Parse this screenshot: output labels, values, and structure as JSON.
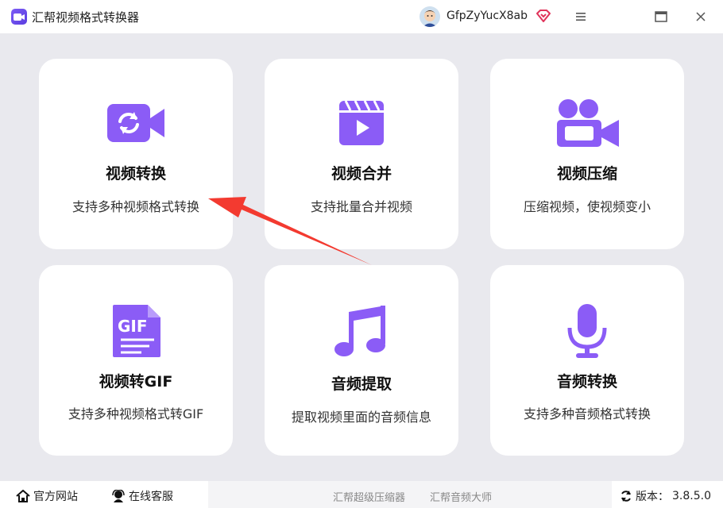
{
  "app": {
    "title": "汇帮视频格式转换器",
    "username": "GfpZyYucX8ab"
  },
  "colors": {
    "accent": "#8b5cf6",
    "arrow": "#f33a30",
    "vip": "#e0335a"
  },
  "cards": [
    {
      "title": "视频转换",
      "desc": "支持多种视频格式转换",
      "icon": "video-convert-icon"
    },
    {
      "title": "视频合并",
      "desc": "支持批量合并视频",
      "icon": "video-merge-icon"
    },
    {
      "title": "视频压缩",
      "desc": "压缩视频，使视频变小",
      "icon": "video-compress-icon"
    },
    {
      "title": "视频转GIF",
      "desc": "支持多种视频格式转GIF",
      "icon": "gif-icon"
    },
    {
      "title": "音频提取",
      "desc": "提取视频里面的音频信息",
      "icon": "music-note-icon"
    },
    {
      "title": "音频转换",
      "desc": "支持多种音频格式转换",
      "icon": "microphone-icon"
    }
  ],
  "footer": {
    "website": "官方网站",
    "support": "在线客服",
    "link1": "汇帮超级压缩器",
    "link2": "汇帮音频大师",
    "version_label": "版本：",
    "version": "3.8.5.0"
  }
}
